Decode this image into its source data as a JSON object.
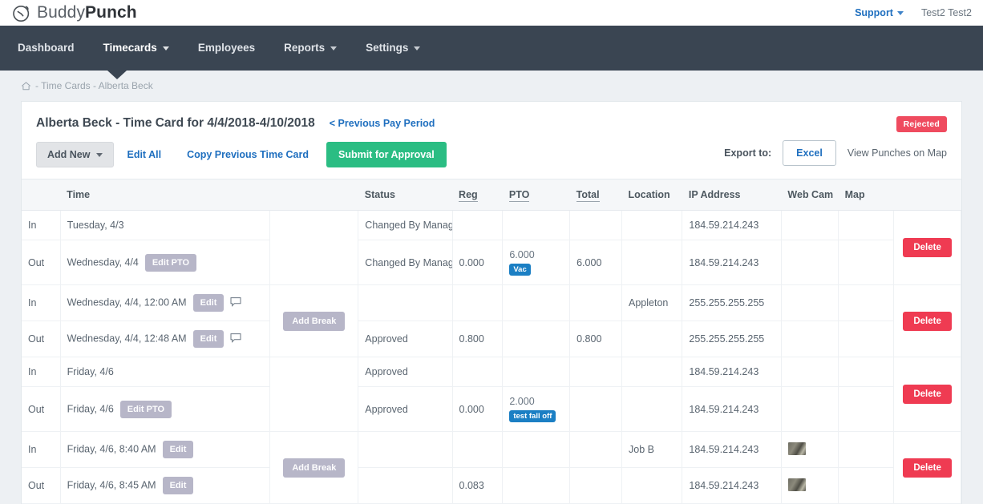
{
  "brand": {
    "name_light": "Buddy",
    "name_bold": "Punch",
    "logo_icon": "stopwatch-icon"
  },
  "topbar": {
    "support_label": "Support",
    "support_caret": "chevron-down-icon",
    "user_name": "Test2 Test2"
  },
  "nav": {
    "items": [
      {
        "label": "Dashboard",
        "has_caret": false,
        "active": false
      },
      {
        "label": "Timecards",
        "has_caret": true,
        "active": true
      },
      {
        "label": "Employees",
        "has_caret": false,
        "active": false
      },
      {
        "label": "Reports",
        "has_caret": true,
        "active": false
      },
      {
        "label": "Settings",
        "has_caret": true,
        "active": false
      }
    ]
  },
  "breadcrumb": {
    "home_icon": "home-icon",
    "trail": "- Time Cards - Alberta Beck"
  },
  "card": {
    "title": "Alberta Beck - Time Card for 4/4/2018-4/10/2018",
    "prev_period": "< Previous Pay Period",
    "status_badge": "Rejected",
    "status_badge_color": "#ef4b5f"
  },
  "toolbar": {
    "add_new": "Add New",
    "add_new_caret": "chevron-down-icon",
    "edit_all": "Edit All",
    "copy_previous": "Copy Previous Time Card",
    "submit": "Submit for Approval",
    "submit_color": "#2bbd83",
    "export_label": "Export to:",
    "excel": "Excel",
    "view_map": "View Punches on Map"
  },
  "table": {
    "headers": [
      {
        "label": "",
        "key": "io"
      },
      {
        "label": "Time",
        "key": "time"
      },
      {
        "label": "",
        "key": "break"
      },
      {
        "label": "Status",
        "key": "status"
      },
      {
        "label": "Reg",
        "key": "reg",
        "sortable": true
      },
      {
        "label": "PTO",
        "key": "pto",
        "sortable": true
      },
      {
        "label": "Total",
        "key": "total",
        "sortable": true
      },
      {
        "label": "Location",
        "key": "location"
      },
      {
        "label": "IP Address",
        "key": "ip"
      },
      {
        "label": "Web Cam",
        "key": "cam"
      },
      {
        "label": "Map",
        "key": "map"
      },
      {
        "label": "",
        "key": "actions"
      }
    ],
    "groups": [
      {
        "break_label": "",
        "delete_label": "Delete",
        "rows": [
          {
            "io": "In",
            "time": "Tuesday, 4/3",
            "edit": "",
            "note": false,
            "status": "Changed By Manager",
            "reg": "",
            "pto": "",
            "pto_tag": "",
            "total": "",
            "location": "",
            "ip": "184.59.214.243",
            "cam": false
          },
          {
            "io": "Out",
            "time": "Wednesday, 4/4",
            "edit": "Edit PTO",
            "note": false,
            "status": "Changed By Manager",
            "reg": "0.000",
            "pto": "6.000",
            "pto_tag": "Vac",
            "total": "6.000",
            "location": "",
            "ip": "184.59.214.243",
            "cam": false
          }
        ]
      },
      {
        "break_label": "Add Break",
        "delete_label": "Delete",
        "rows": [
          {
            "io": "In",
            "time": "Wednesday, 4/4, 12:00 AM",
            "edit": "Edit",
            "note": true,
            "status": "",
            "reg": "",
            "pto": "",
            "pto_tag": "",
            "total": "",
            "location": "Appleton",
            "ip": "255.255.255.255",
            "cam": false
          },
          {
            "io": "Out",
            "time": "Wednesday, 4/4, 12:48 AM",
            "edit": "Edit",
            "note": true,
            "status": "Approved",
            "reg": "0.800",
            "pto": "",
            "pto_tag": "",
            "total": "0.800",
            "location": "",
            "ip": "255.255.255.255",
            "cam": false
          }
        ]
      },
      {
        "break_label": "",
        "delete_label": "Delete",
        "rows": [
          {
            "io": "In",
            "time": "Friday, 4/6",
            "edit": "",
            "note": false,
            "status": "Approved",
            "reg": "",
            "pto": "",
            "pto_tag": "",
            "total": "",
            "location": "",
            "ip": "184.59.214.243",
            "cam": false
          },
          {
            "io": "Out",
            "time": "Friday, 4/6",
            "edit": "Edit PTO",
            "note": false,
            "status": "Approved",
            "reg": "0.000",
            "pto": "2.000",
            "pto_tag": "test fall off",
            "total": "",
            "location": "",
            "ip": "184.59.214.243",
            "cam": false
          }
        ]
      },
      {
        "break_label": "Add Break",
        "delete_label": "Delete",
        "rows": [
          {
            "io": "In",
            "time": "Friday, 4/6, 8:40 AM",
            "edit": "Edit",
            "note": false,
            "status": "",
            "reg": "",
            "pto": "",
            "pto_tag": "",
            "total": "",
            "location": "Job B",
            "ip": "184.59.214.243",
            "cam": true
          },
          {
            "io": "Out",
            "time": "Friday, 4/6, 8:45 AM",
            "edit": "Edit",
            "note": false,
            "status": "",
            "reg": "0.083",
            "pto": "",
            "pto_tag": "",
            "total": "",
            "location": "",
            "ip": "184.59.214.243",
            "cam": true
          }
        ]
      }
    ]
  }
}
